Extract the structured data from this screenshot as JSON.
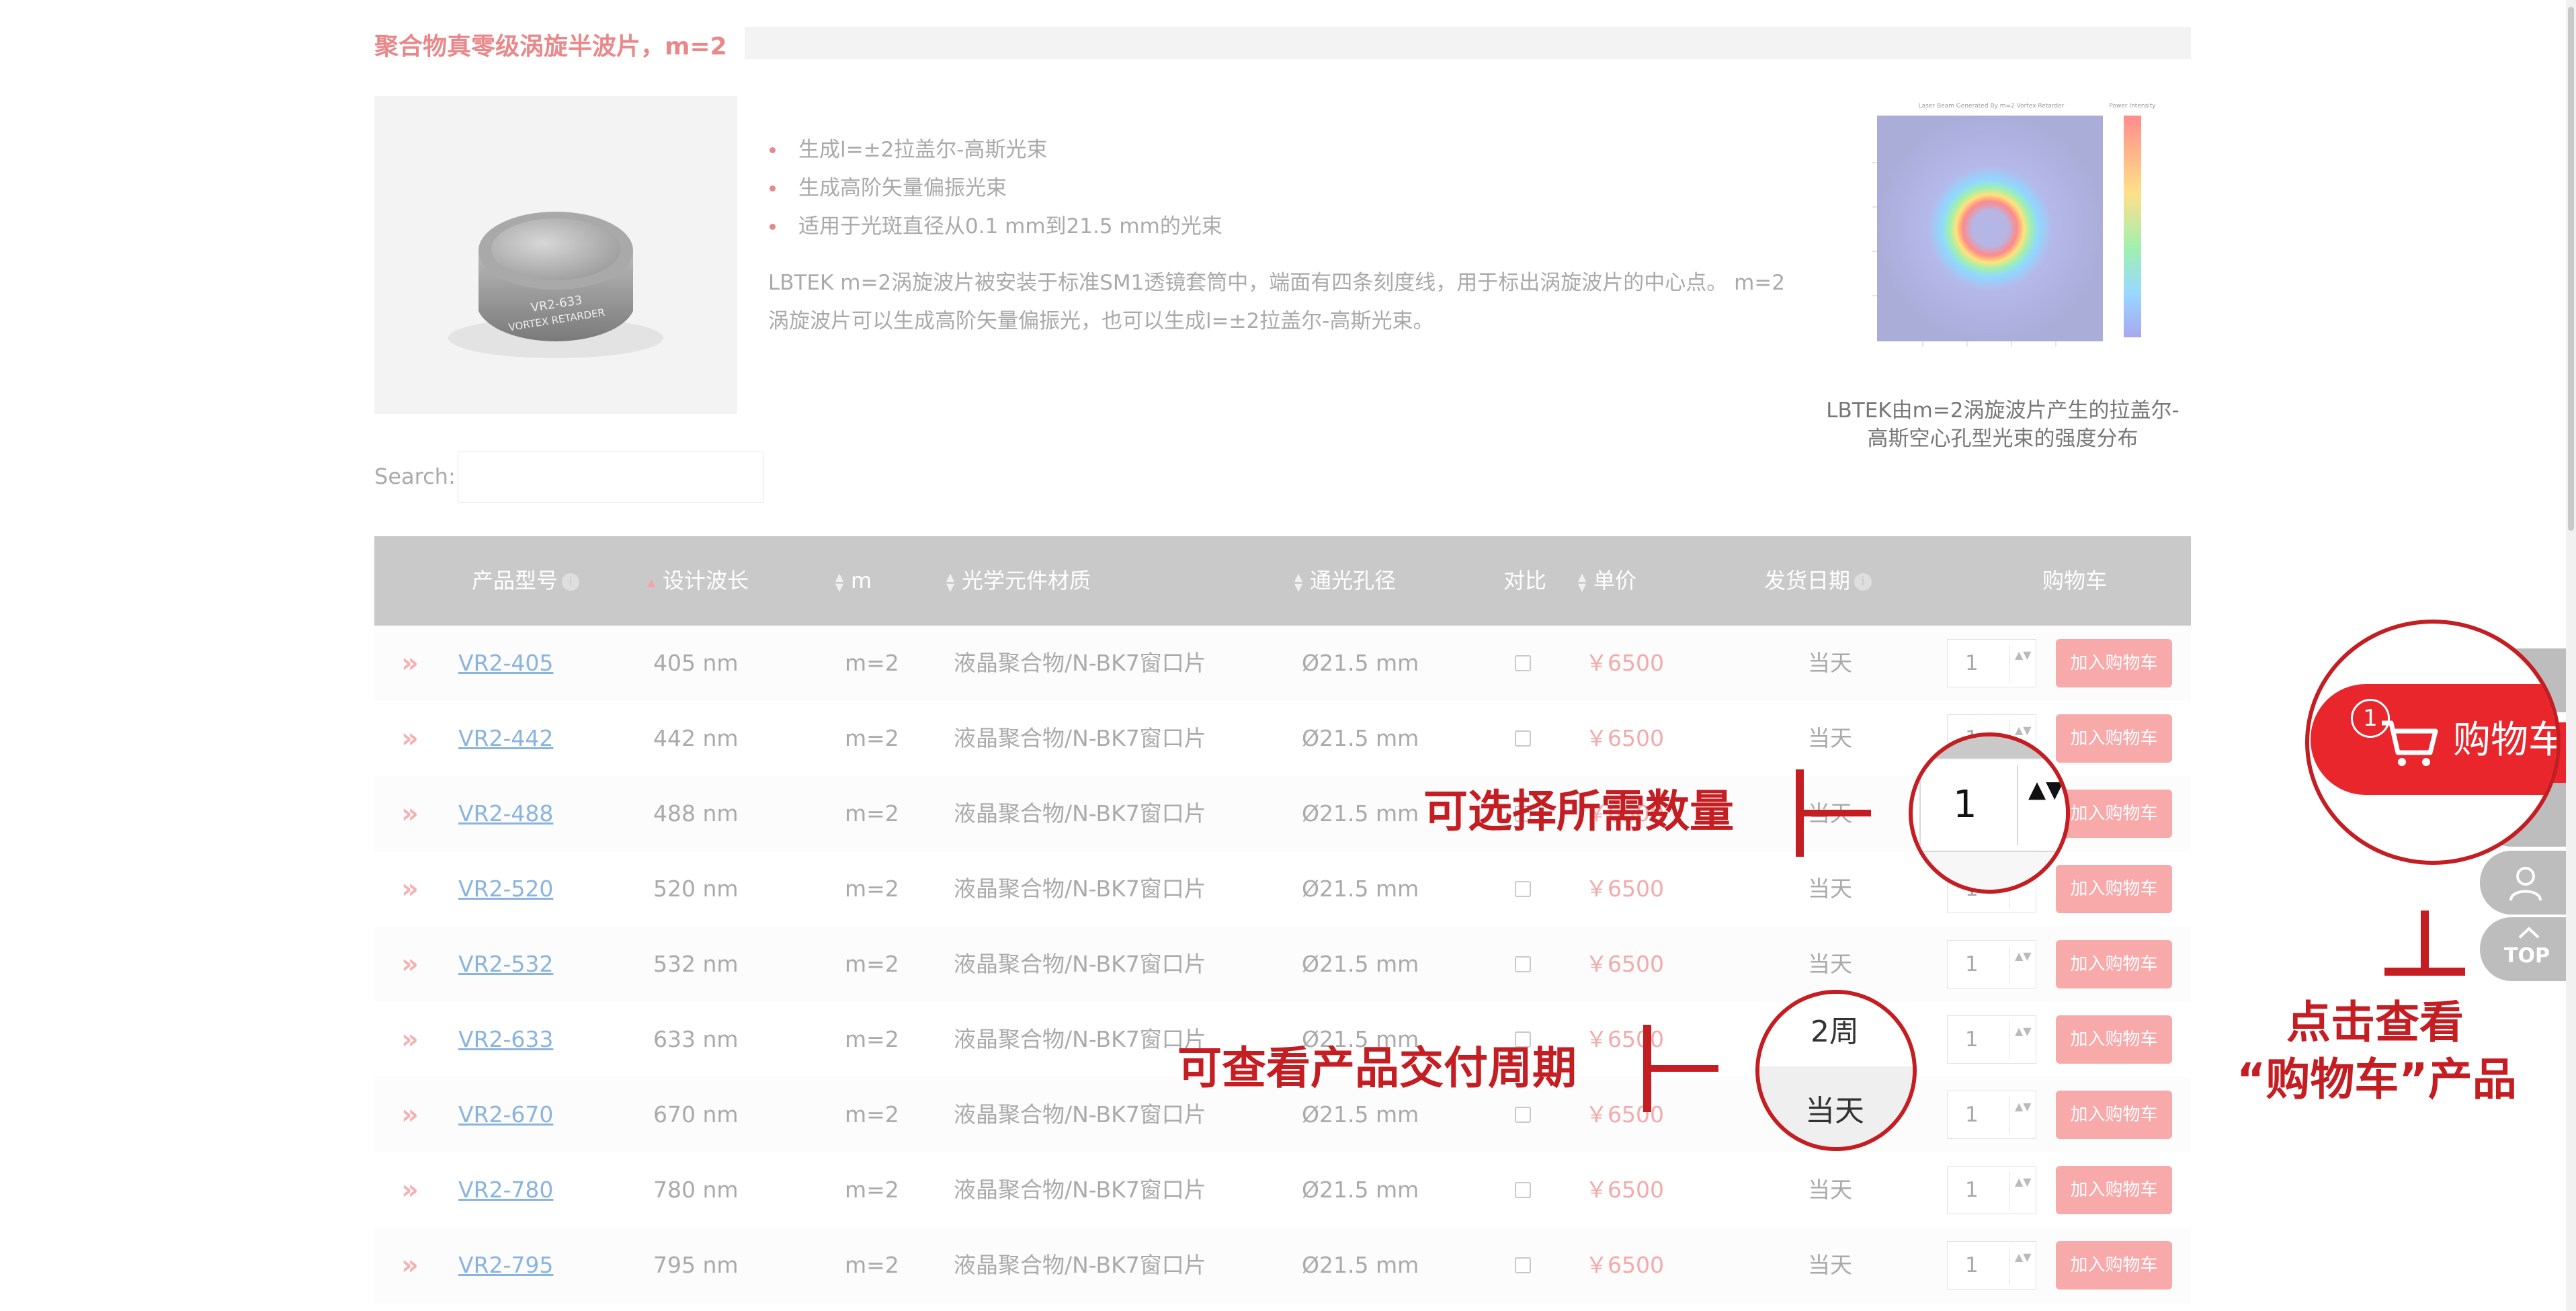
{
  "product": {
    "title": "聚合物真零级涡旋半波片，m=2",
    "features": [
      "生成l=±2拉盖尔-高斯光束",
      "生成高阶矢量偏振光束",
      "适用于光斑直径从0.1 mm到21.5 mm的光束"
    ],
    "description": "LBTEK m=2涡旋波片被安装于标准SM1透镜套筒中，端面有四条刻度线，用于标出涡旋波片的中心点。 m=2涡旋波片可以生成高阶矢量偏振光，也可以生成l=±2拉盖尔-高斯光束。",
    "lens_label_line1": "VR2-633",
    "lens_label_line2": "VORTEX RETARDER",
    "chart_title": "Laser Beam Generated By m=2 Vortex Retarder",
    "chart_colorbar_title": "Power Intensity",
    "chart_caption": "LBTEK由m=2涡旋波片产生的拉盖尔-高斯空心孔型光束的强度分布"
  },
  "search": {
    "label": "Search:",
    "value": ""
  },
  "table": {
    "headers": {
      "model": "产品型号",
      "wavelength": "设计波长",
      "m": "m",
      "material": "光学元件材质",
      "aperture": "通光孔径",
      "compare": "对比",
      "price": "单价",
      "ship": "发货日期",
      "cart": "购物车"
    },
    "info_glyph": "i",
    "qty_arrows": "▲▼",
    "rows": [
      {
        "model": "VR2-405",
        "wavelength": "405 nm",
        "m": "m=2",
        "material": "液晶聚合物/N-BK7窗口片",
        "aperture": "Ø21.5 mm",
        "price": "￥6500",
        "ship": "当天",
        "qty": "1",
        "button": "加入购物车"
      },
      {
        "model": "VR2-442",
        "wavelength": "442 nm",
        "m": "m=2",
        "material": "液晶聚合物/N-BK7窗口片",
        "aperture": "Ø21.5 mm",
        "price": "￥6500",
        "ship": "当天",
        "qty": "1",
        "button": "加入购物车"
      },
      {
        "model": "VR2-488",
        "wavelength": "488 nm",
        "m": "m=2",
        "material": "液晶聚合物/N-BK7窗口片",
        "aperture": "Ø21.5 mm",
        "price": "￥6500",
        "ship": "当天",
        "qty": "1",
        "button": "加入购物车"
      },
      {
        "model": "VR2-520",
        "wavelength": "520 nm",
        "m": "m=2",
        "material": "液晶聚合物/N-BK7窗口片",
        "aperture": "Ø21.5 mm",
        "price": "￥6500",
        "ship": "当天",
        "qty": "1",
        "button": "加入购物车"
      },
      {
        "model": "VR2-532",
        "wavelength": "532 nm",
        "m": "m=2",
        "material": "液晶聚合物/N-BK7窗口片",
        "aperture": "Ø21.5 mm",
        "price": "￥6500",
        "ship": "当天",
        "qty": "1",
        "button": "加入购物车"
      },
      {
        "model": "VR2-633",
        "wavelength": "633 nm",
        "m": "m=2",
        "material": "液晶聚合物/N-BK7窗口片",
        "aperture": "Ø21.5 mm",
        "price": "￥6500",
        "ship": "2周",
        "qty": "1",
        "button": "加入购物车"
      },
      {
        "model": "VR2-670",
        "wavelength": "670 nm",
        "m": "m=2",
        "material": "液晶聚合物/N-BK7窗口片",
        "aperture": "Ø21.5 mm",
        "price": "￥6500",
        "ship": "当天",
        "qty": "1",
        "button": "加入购物车"
      },
      {
        "model": "VR2-780",
        "wavelength": "780 nm",
        "m": "m=2",
        "material": "液晶聚合物/N-BK7窗口片",
        "aperture": "Ø21.5 mm",
        "price": "￥6500",
        "ship": "当天",
        "qty": "1",
        "button": "加入购物车"
      },
      {
        "model": "VR2-795",
        "wavelength": "795 nm",
        "m": "m=2",
        "material": "液晶聚合物/N-BK7窗口片",
        "aperture": "Ø21.5 mm",
        "price": "￥6500",
        "ship": "当天",
        "qty": "1",
        "button": "加入购物车"
      }
    ]
  },
  "annotations": {
    "quantity_text": "可选择所需数量",
    "quantity_zoom_value": "1",
    "delivery_text": "可查看产品交付周期",
    "delivery_zoom_top": "2周",
    "delivery_zoom_bottom": "当天",
    "cart_line1": "点击查看",
    "cart_line2": "“购物车”产品",
    "cart_badge": "1",
    "cart_label": "购物车"
  },
  "sidebar": {
    "top_label": "TOP"
  },
  "colors": {
    "accent": "#c41d22",
    "cart_red": "#e8262b",
    "button_pink": "#f8a9aa",
    "link_blue": "#8ab4e0"
  }
}
